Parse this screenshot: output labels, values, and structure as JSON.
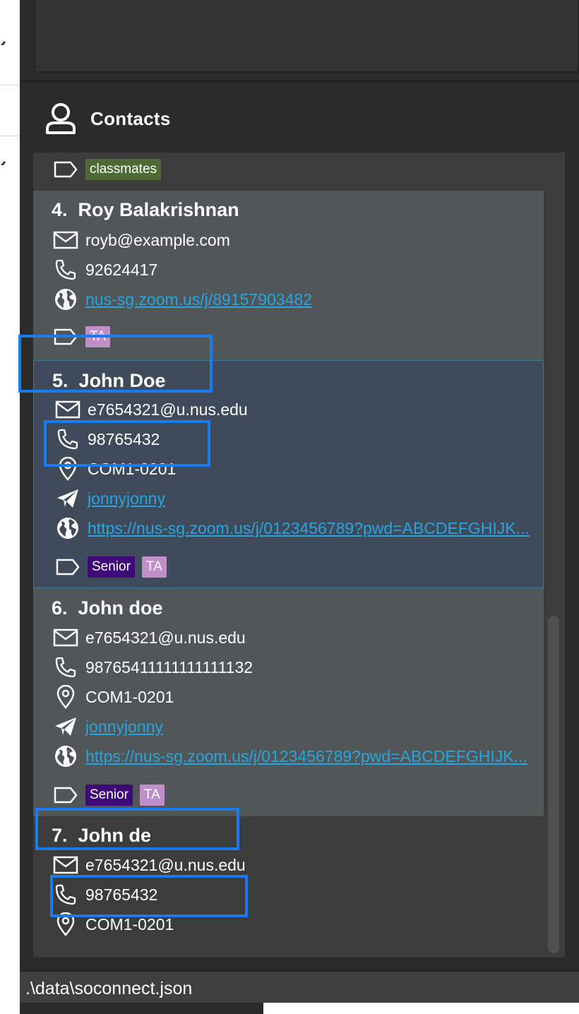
{
  "contacts_panel": {
    "title": "Contacts"
  },
  "top_card": {
    "tags": [
      "classmates"
    ]
  },
  "persons": [
    {
      "index": "4.",
      "name": "Roy Balakrishnan",
      "email": "royb@example.com",
      "phone": "92624417",
      "zoom": "nus-sg.zoom.us/j/89157903482",
      "tags": [
        "TA"
      ]
    },
    {
      "index": "5.",
      "name": "John Doe",
      "email": "e7654321@u.nus.edu",
      "phone": "98765432",
      "address": "COM1-0201",
      "telegram": "jonnyjonny",
      "zoom": "https://nus-sg.zoom.us/j/0123456789?pwd=ABCDEFGHIJK...",
      "tags": [
        "Senior",
        "TA"
      ],
      "selected": true
    },
    {
      "index": "6.",
      "name": "John doe",
      "email": "e7654321@u.nus.edu",
      "phone": "98765411111111111132",
      "address": "COM1-0201",
      "telegram": "jonnyjonny",
      "zoom": "https://nus-sg.zoom.us/j/0123456789?pwd=ABCDEFGHIJK...",
      "tags": [
        "Senior",
        "TA"
      ]
    },
    {
      "index": "7.",
      "name": "John de",
      "email": "e7654321@u.nus.edu",
      "phone": "98765432",
      "address": "COM1-0201"
    }
  ],
  "status_bar": {
    "path": ".\\data\\soconnect.json"
  },
  "colors": {
    "tag_classmates": "#4f6b35",
    "tag_senior": "#3e0a7a",
    "tag_ta": "#c08ec8",
    "link": "#26a5e0",
    "highlight_box": "#1a7bf0"
  }
}
